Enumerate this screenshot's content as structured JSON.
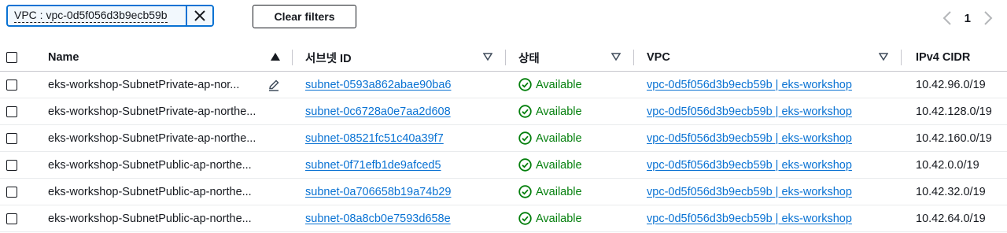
{
  "filter": {
    "token_label": "VPC : vpc-0d5f056d3b9ecb59b"
  },
  "clear_filters_label": "Clear filters",
  "pagination": {
    "current_page": "1"
  },
  "columns": {
    "name": "Name",
    "subnet_id": "서브넷 ID",
    "state": "상태",
    "vpc": "VPC",
    "cidr": "IPv4 CIDR"
  },
  "rows": [
    {
      "name": "eks-workshop-SubnetPrivate-ap-nor...",
      "subnet_id": "subnet-0593a862abae90ba6",
      "state": "Available",
      "vpc": "vpc-0d5f056d3b9ecb59b | eks-workshop",
      "cidr": "10.42.96.0/19"
    },
    {
      "name": "eks-workshop-SubnetPrivate-ap-northe...",
      "subnet_id": "subnet-0c6728a0e7aa2d608",
      "state": "Available",
      "vpc": "vpc-0d5f056d3b9ecb59b | eks-workshop",
      "cidr": "10.42.128.0/19"
    },
    {
      "name": "eks-workshop-SubnetPrivate-ap-northe...",
      "subnet_id": "subnet-08521fc51c40a39f7",
      "state": "Available",
      "vpc": "vpc-0d5f056d3b9ecb59b | eks-workshop",
      "cidr": "10.42.160.0/19"
    },
    {
      "name": "eks-workshop-SubnetPublic-ap-northe...",
      "subnet_id": "subnet-0f71efb1de9afced5",
      "state": "Available",
      "vpc": "vpc-0d5f056d3b9ecb59b | eks-workshop",
      "cidr": "10.42.0.0/19"
    },
    {
      "name": "eks-workshop-SubnetPublic-ap-northe...",
      "subnet_id": "subnet-0a706658b19a74b29",
      "state": "Available",
      "vpc": "vpc-0d5f056d3b9ecb59b | eks-workshop",
      "cidr": "10.42.32.0/19"
    },
    {
      "name": "eks-workshop-SubnetPublic-ap-northe...",
      "subnet_id": "subnet-08a8cb0e7593d658e",
      "state": "Available",
      "vpc": "vpc-0d5f056d3b9ecb59b | eks-workshop",
      "cidr": "10.42.64.0/19"
    }
  ],
  "colors": {
    "link": "#0972d3",
    "success": "#037f0c",
    "text": "#16191f",
    "divider": "#c6c6cd"
  }
}
